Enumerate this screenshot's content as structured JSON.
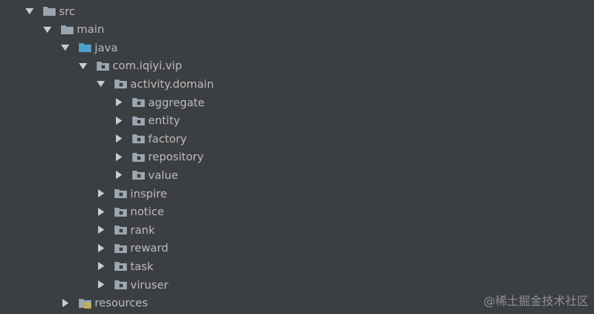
{
  "tree": {
    "rows": [
      {
        "label": "src",
        "expanded": true,
        "folder": "plain",
        "depth": 0
      },
      {
        "label": "main",
        "expanded": true,
        "folder": "plain",
        "depth": 1
      },
      {
        "label": "java",
        "expanded": true,
        "folder": "source-root",
        "depth": 2
      },
      {
        "label": "com.iqiyi.vip",
        "expanded": true,
        "folder": "package",
        "depth": 3
      },
      {
        "label": "activity.domain",
        "expanded": true,
        "folder": "package",
        "depth": 4
      },
      {
        "label": "aggregate",
        "expanded": false,
        "folder": "package",
        "depth": 5
      },
      {
        "label": "entity",
        "expanded": false,
        "folder": "package",
        "depth": 5
      },
      {
        "label": "factory",
        "expanded": false,
        "folder": "package",
        "depth": 5
      },
      {
        "label": "repository",
        "expanded": false,
        "folder": "package",
        "depth": 5
      },
      {
        "label": "value",
        "expanded": false,
        "folder": "package",
        "depth": 5
      },
      {
        "label": "inspire",
        "expanded": false,
        "folder": "package",
        "depth": 4
      },
      {
        "label": "notice",
        "expanded": false,
        "folder": "package",
        "depth": 4
      },
      {
        "label": "rank",
        "expanded": false,
        "folder": "package",
        "depth": 4
      },
      {
        "label": "reward",
        "expanded": false,
        "folder": "package",
        "depth": 4
      },
      {
        "label": "task",
        "expanded": false,
        "folder": "package",
        "depth": 4
      },
      {
        "label": "viruser",
        "expanded": false,
        "folder": "package",
        "depth": 4
      },
      {
        "label": "resources",
        "expanded": false,
        "folder": "resources-root",
        "depth": 2
      }
    ]
  },
  "watermark": "@稀土掘金技术社区",
  "colors": {
    "background": "#3c3f41",
    "text": "#bbbbbb",
    "arrow": "#c9cbcd",
    "folder": "#9aa7b0",
    "source_root": "#4d9fcc",
    "package_dot": "#3c3f41",
    "resources_stripes": "#d8b233"
  },
  "icons": {
    "expanded": "triangle-down-icon",
    "collapsed": "triangle-right-icon",
    "plain": "folder-icon",
    "source-root": "source-root-folder-icon",
    "package": "package-folder-icon",
    "resources-root": "resources-folder-icon"
  }
}
